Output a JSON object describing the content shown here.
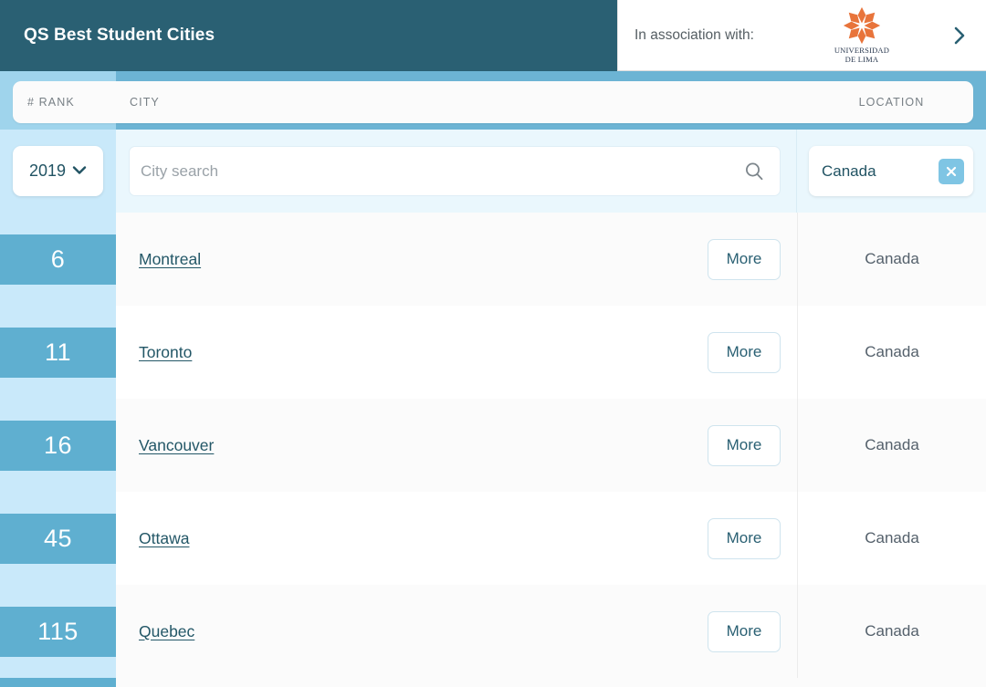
{
  "header": {
    "title": "QS Best Student Cities",
    "association_label": "In association with:",
    "partner_logo_icon": "eight-point-star-rosette-icon",
    "partner_name_line1": "UNIVERSIDAD",
    "partner_name_line2": "DE LIMA",
    "next_arrow_icon": "chevron-right-icon",
    "brand_color": "#2a6073",
    "partner_logo_color": "#e8743b"
  },
  "table": {
    "columns": {
      "rank": "# RANK",
      "city": "CITY",
      "location": "LOCATION"
    },
    "filters": {
      "year_value": "2019",
      "year_caret_icon": "chevron-down-icon",
      "search_value": "",
      "search_placeholder": "City search",
      "search_icon": "search-icon",
      "location_chip_label": "Canada",
      "location_chip_clear_icon": "close-x-icon"
    },
    "more_label": "More",
    "rows": [
      {
        "rank": "6",
        "city": "Montreal",
        "location": "Canada"
      },
      {
        "rank": "11",
        "city": "Toronto",
        "location": "Canada"
      },
      {
        "rank": "16",
        "city": "Vancouver",
        "location": "Canada"
      },
      {
        "rank": "45",
        "city": "Ottawa",
        "location": "Canada"
      },
      {
        "rank": "115",
        "city": "Quebec",
        "location": "Canada"
      }
    ]
  },
  "colors": {
    "header_teal": "#2a6073",
    "rank_band_blue": "#5fafd0",
    "rank_cell_light": "#c9e9fa",
    "column_head_blue": "#6cb4d4",
    "rank_head_blue": "#9fd4ec",
    "filter_bg": "#eaf7fd",
    "chip_clear_blue": "#7fc5e4",
    "link_teal": "#235767"
  }
}
